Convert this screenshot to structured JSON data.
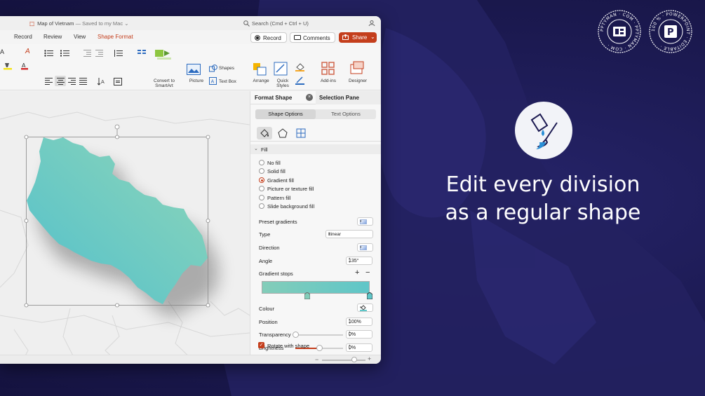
{
  "window": {
    "title": "Map of Vietnam",
    "subtitle": "— Saved to my Mac",
    "search_placeholder": "Search (Cmd + Ctrl + U)"
  },
  "tabs": [
    {
      "label": "Record"
    },
    {
      "label": "Review"
    },
    {
      "label": "View"
    },
    {
      "label": "Shape Format",
      "active": true
    }
  ],
  "actions": {
    "record": "Record",
    "comments": "Comments",
    "share": "Share"
  },
  "ribbon": {
    "convert_smartart": [
      "Convert to",
      "SmartArt"
    ],
    "picture": "Picture",
    "shapes": "Shapes",
    "text_box": "Text Box",
    "arrange": "Arrange",
    "quick_styles": [
      "Quick",
      "Styles"
    ],
    "add_ins": "Add-ins",
    "designer": "Designer"
  },
  "pane": {
    "tab_format": "Format Shape",
    "tab_selection": "Selection Pane",
    "shape_options": "Shape Options",
    "text_options": "Text Options",
    "section_fill": "Fill",
    "fill_options": [
      {
        "label": "No fill",
        "selected": false
      },
      {
        "label": "Solid fill",
        "selected": false
      },
      {
        "label": "Gradient fill",
        "selected": true
      },
      {
        "label": "Picture or texture fill",
        "selected": false
      },
      {
        "label": "Pattern fill",
        "selected": false
      },
      {
        "label": "Slide background fill",
        "selected": false
      }
    ],
    "preset_gradients": "Preset gradients",
    "type_label": "Type",
    "type_value": "Linear",
    "direction_label": "Direction",
    "angle_label": "Angle",
    "angle_value": "135°",
    "gradient_stops_label": "Gradient stops",
    "colour_label": "Colour",
    "position_label": "Position",
    "position_value": "100%",
    "transparency_label": "Transparency",
    "transparency_value": "0%",
    "transparency_level": 0,
    "brightness_label": "Brightness",
    "brightness_value": "0%",
    "brightness_level": 0.5,
    "rotate_with_shape": "Rotate with shape"
  },
  "promo": {
    "line1": "Edit every division",
    "line2": "as a regular shape",
    "badge1_ring": "PPTYMAN · COM · PPTYMAN · COM ·",
    "badge2_ring": "100 % · POWERPOINT · EDITABLE ·"
  },
  "colors": {
    "accent": "#c43e1c",
    "background": "#1c1a52",
    "gradient_start": "#83cdb9",
    "gradient_end": "#5fc6c8"
  }
}
